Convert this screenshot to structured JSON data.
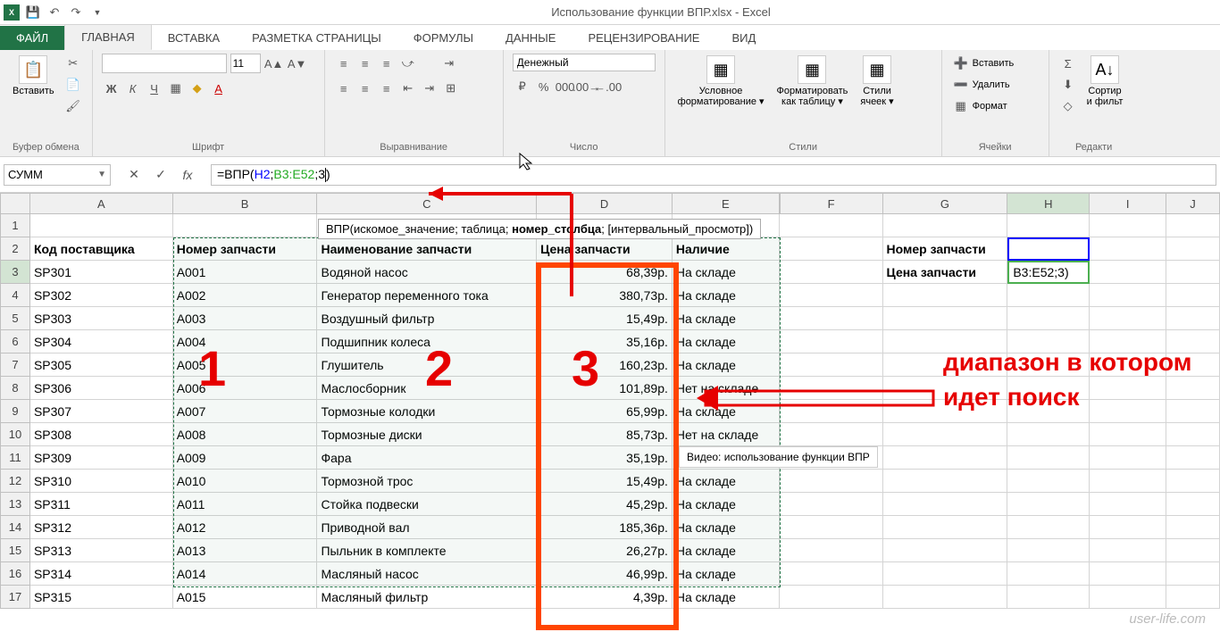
{
  "title": "Использование функции ВПР.xlsx - Excel",
  "qat": {
    "save": "save",
    "undo": "undo",
    "redo": "redo"
  },
  "tabs": [
    "ФАЙЛ",
    "ГЛАВНАЯ",
    "ВСТАВКА",
    "РАЗМЕТКА СТРАНИЦЫ",
    "ФОРМУЛЫ",
    "ДАННЫЕ",
    "РЕЦЕНЗИРОВАНИЕ",
    "ВИД"
  ],
  "ribbon": {
    "paste": "Вставить",
    "clipboard": "Буфер обмена",
    "font": "Шрифт",
    "font_size": "11",
    "alignment": "Выравнивание",
    "number": "Число",
    "number_format": "Денежный",
    "styles": "Стили",
    "cond_fmt1": "Условное",
    "cond_fmt2": "форматирование",
    "fmt_table1": "Форматировать",
    "fmt_table2": "как таблицу",
    "cell_styles1": "Стили",
    "cell_styles2": "ячеек",
    "cells": "Ячейки",
    "insert": "Вставить",
    "delete": "Удалить",
    "format": "Формат",
    "editing": "Редакти",
    "sort1": "Сортир",
    "sort2": "и фильт"
  },
  "namebox": "СУММ",
  "formula": "=ВПР(H2;B3:E52;3)",
  "tooltip_prefix": "ВПР(искомое_значение; таблица; ",
  "tooltip_bold": "номер_столбца",
  "tooltip_suffix": "; [интервальный_просмотр])",
  "columns": [
    "A",
    "B",
    "C",
    "D",
    "E",
    "F",
    "G",
    "H",
    "I",
    "J"
  ],
  "headers": {
    "A": "Код поставщика",
    "B": "Номер запчасти",
    "C": "Наименование запчасти",
    "D": "Цена запчасти",
    "E": "Наличие",
    "G2": "Номер запчасти",
    "G3": "Цена запчасти",
    "H3": "B3:E52;3)"
  },
  "rows": [
    {
      "n": 3,
      "a": "SP301",
      "b": "A001",
      "c": "Водяной насос",
      "d": "68,39р.",
      "e": "На складе"
    },
    {
      "n": 4,
      "a": "SP302",
      "b": "A002",
      "c": "Генератор переменного тока",
      "d": "380,73р.",
      "e": "На складе"
    },
    {
      "n": 5,
      "a": "SP303",
      "b": "A003",
      "c": "Воздушный фильтр",
      "d": "15,49р.",
      "e": "На складе"
    },
    {
      "n": 6,
      "a": "SP304",
      "b": "A004",
      "c": "Подшипник колеса",
      "d": "35,16р.",
      "e": "На складе"
    },
    {
      "n": 7,
      "a": "SP305",
      "b": "A005",
      "c": "Глушитель",
      "d": "160,23р.",
      "e": "На складе"
    },
    {
      "n": 8,
      "a": "SP306",
      "b": "A006",
      "c": "Маслосборник",
      "d": "101,89р.",
      "e": "Нет на складе"
    },
    {
      "n": 9,
      "a": "SP307",
      "b": "A007",
      "c": "Тормозные колодки",
      "d": "65,99р.",
      "e": "На складе"
    },
    {
      "n": 10,
      "a": "SP308",
      "b": "A008",
      "c": "Тормозные диски",
      "d": "85,73р.",
      "e": "Нет на складе"
    },
    {
      "n": 11,
      "a": "SP309",
      "b": "A009",
      "c": "Фара",
      "d": "35,19р.",
      "e": "На складе"
    },
    {
      "n": 12,
      "a": "SP310",
      "b": "A010",
      "c": "Тормозной трос",
      "d": "15,49р.",
      "e": "На складе"
    },
    {
      "n": 13,
      "a": "SP311",
      "b": "A011",
      "c": "Стойка подвески",
      "d": "45,29р.",
      "e": "На складе"
    },
    {
      "n": 14,
      "a": "SP312",
      "b": "A012",
      "c": "Приводной вал",
      "d": "185,36р.",
      "e": "На складе"
    },
    {
      "n": 15,
      "a": "SP313",
      "b": "A013",
      "c": "Пыльник в комплекте",
      "d": "26,27р.",
      "e": "На складе"
    },
    {
      "n": 16,
      "a": "SP314",
      "b": "A014",
      "c": "Масляный насос",
      "d": "46,99р.",
      "e": "На складе"
    },
    {
      "n": 17,
      "a": "SP315",
      "b": "A015",
      "c": "Масляный фильтр",
      "d": "4,39р.",
      "e": "На складе"
    }
  ],
  "annotations": {
    "num1": "1",
    "num2": "2",
    "num3": "3",
    "text": "диапазон в котором идет поиск",
    "video_tip": "Видео: использование функции ВПР"
  },
  "watermark": "user-life.com"
}
